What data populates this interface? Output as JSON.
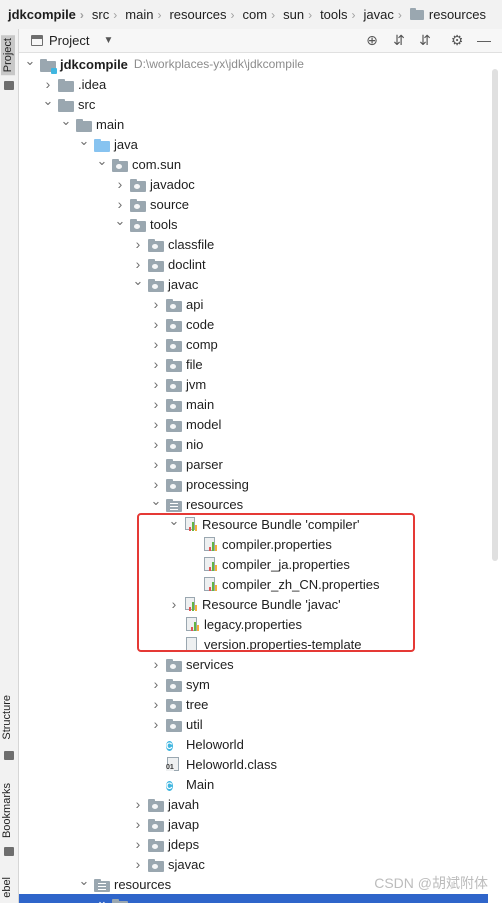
{
  "breadcrumb": [
    "jdkcompile",
    "src",
    "main",
    "resources",
    "com",
    "sun",
    "tools",
    "javac",
    "resources"
  ],
  "sidebar": {
    "project": "Project",
    "structure": "Structure",
    "bookmarks": "Bookmarks",
    "third": "ebel"
  },
  "panel": {
    "title": "Project",
    "dropdown": "▼",
    "locate": "⊕",
    "expand": "⇵",
    "collapse": "⇵",
    "settings": "⚙",
    "minimize": "—"
  },
  "tree": [
    {
      "label": "jdkcompile",
      "path": "D:\\workplaces-yx\\jdk\\jdkcompile",
      "depth": 0,
      "arrow": "down",
      "icon": "module",
      "bold": true
    },
    {
      "label": ".idea",
      "depth": 1,
      "arrow": "right",
      "icon": "folder"
    },
    {
      "label": "src",
      "depth": 1,
      "arrow": "down",
      "icon": "folder"
    },
    {
      "label": "main",
      "depth": 2,
      "arrow": "down",
      "icon": "folder"
    },
    {
      "label": "java",
      "depth": 3,
      "arrow": "down",
      "icon": "source"
    },
    {
      "label": "com.sun",
      "depth": 4,
      "arrow": "down",
      "icon": "package"
    },
    {
      "label": "javadoc",
      "depth": 5,
      "arrow": "right",
      "icon": "package"
    },
    {
      "label": "source",
      "depth": 5,
      "arrow": "right",
      "icon": "package"
    },
    {
      "label": "tools",
      "depth": 5,
      "arrow": "down",
      "icon": "package"
    },
    {
      "label": "classfile",
      "depth": 6,
      "arrow": "right",
      "icon": "package"
    },
    {
      "label": "doclint",
      "depth": 6,
      "arrow": "right",
      "icon": "package"
    },
    {
      "label": "javac",
      "depth": 6,
      "arrow": "down",
      "icon": "package"
    },
    {
      "label": "api",
      "depth": 7,
      "arrow": "right",
      "icon": "package"
    },
    {
      "label": "code",
      "depth": 7,
      "arrow": "right",
      "icon": "package"
    },
    {
      "label": "comp",
      "depth": 7,
      "arrow": "right",
      "icon": "package"
    },
    {
      "label": "file",
      "depth": 7,
      "arrow": "right",
      "icon": "package"
    },
    {
      "label": "jvm",
      "depth": 7,
      "arrow": "right",
      "icon": "package"
    },
    {
      "label": "main",
      "depth": 7,
      "arrow": "right",
      "icon": "package"
    },
    {
      "label": "model",
      "depth": 7,
      "arrow": "right",
      "icon": "package"
    },
    {
      "label": "nio",
      "depth": 7,
      "arrow": "right",
      "icon": "package"
    },
    {
      "label": "parser",
      "depth": 7,
      "arrow": "right",
      "icon": "package"
    },
    {
      "label": "processing",
      "depth": 7,
      "arrow": "right",
      "icon": "package"
    },
    {
      "label": "resources",
      "depth": 7,
      "arrow": "down",
      "icon": "resfolder"
    },
    {
      "label": "Resource Bundle 'compiler'",
      "depth": 8,
      "arrow": "down",
      "icon": "bundle"
    },
    {
      "label": "compiler.properties",
      "depth": 9,
      "arrow": "none",
      "icon": "properties"
    },
    {
      "label": "compiler_ja.properties",
      "depth": 9,
      "arrow": "none",
      "icon": "properties"
    },
    {
      "label": "compiler_zh_CN.properties",
      "depth": 9,
      "arrow": "none",
      "icon": "properties"
    },
    {
      "label": "Resource Bundle 'javac'",
      "depth": 8,
      "arrow": "right",
      "icon": "bundle"
    },
    {
      "label": "legacy.properties",
      "depth": 8,
      "arrow": "none",
      "icon": "properties"
    },
    {
      "label": "version.properties-template",
      "depth": 8,
      "arrow": "none",
      "icon": "file"
    },
    {
      "label": "services",
      "depth": 7,
      "arrow": "right",
      "icon": "package"
    },
    {
      "label": "sym",
      "depth": 7,
      "arrow": "right",
      "icon": "package"
    },
    {
      "label": "tree",
      "depth": 7,
      "arrow": "right",
      "icon": "package"
    },
    {
      "label": "util",
      "depth": 7,
      "arrow": "right",
      "icon": "package"
    },
    {
      "label": "Heloworld",
      "depth": 7,
      "arrow": "none",
      "icon": "class"
    },
    {
      "label": "Heloworld.class",
      "depth": 7,
      "arrow": "none",
      "icon": "classfile"
    },
    {
      "label": "Main",
      "depth": 7,
      "arrow": "none",
      "icon": "class"
    },
    {
      "label": "javah",
      "depth": 6,
      "arrow": "right",
      "icon": "package"
    },
    {
      "label": "javap",
      "depth": 6,
      "arrow": "right",
      "icon": "package"
    },
    {
      "label": "jdeps",
      "depth": 6,
      "arrow": "right",
      "icon": "package"
    },
    {
      "label": "sjavac",
      "depth": 6,
      "arrow": "right",
      "icon": "package"
    },
    {
      "label": "resources",
      "depth": 3,
      "arrow": "down",
      "icon": "resfolder"
    },
    {
      "label": "",
      "depth": 4,
      "arrow": "down",
      "icon": "folder",
      "selected": true
    }
  ],
  "watermark": "CSDN @胡斌附体",
  "colors": {
    "selection": "#2f65ca",
    "highlight": "#e53935",
    "source_folder": "#87c3f0",
    "folder": "#9aa7b0"
  }
}
